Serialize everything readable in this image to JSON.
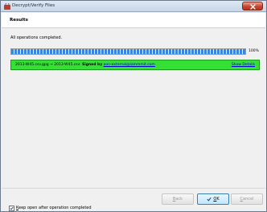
{
  "window": {
    "title": "Decrypt/Verify Files",
    "close_icon": "close-icon",
    "app_icon": "app-icon"
  },
  "header": {
    "title": "Results"
  },
  "main": {
    "status_text": "All operations completed.",
    "progress": {
      "value": 100,
      "label": "100%"
    },
    "result": {
      "files": "2013-W45.csv.gpg → 2013-W45.csv:",
      "signed_by": "Signed by",
      "email": "aon-external@iammmit.com",
      "details_link": "Show Details",
      "status_color": "#35e035"
    },
    "keep_open": {
      "checked": true,
      "label_first": "K",
      "label_rest": "eep open after operation completed"
    }
  },
  "footer": {
    "back": {
      "first": "B",
      "rest": "ack"
    },
    "ok": {
      "first": "O",
      "rest": "K"
    },
    "cancel": {
      "first": "C",
      "rest": "ancel"
    }
  }
}
